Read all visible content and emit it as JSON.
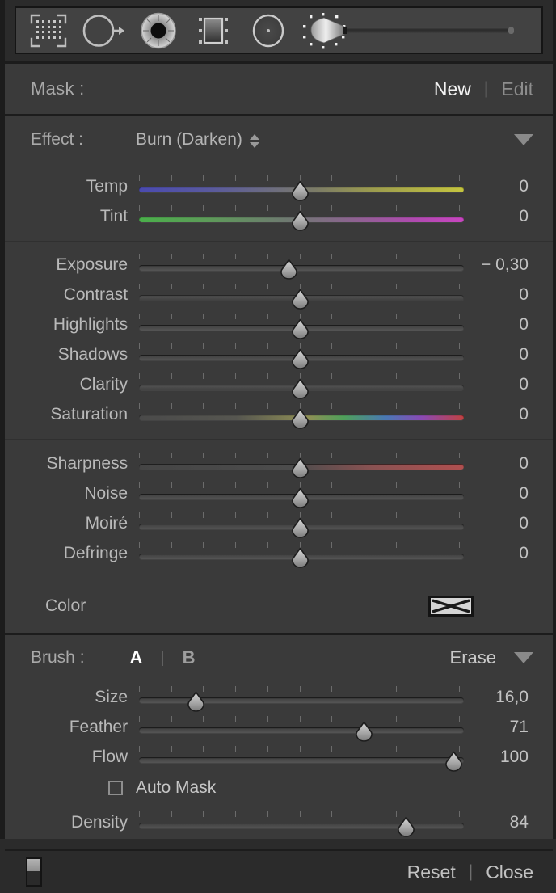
{
  "toolbar": {
    "tools": [
      {
        "name": "crop-overlay-icon",
        "label": "Crop Overlay"
      },
      {
        "name": "spot-removal-icon",
        "label": "Spot Removal"
      },
      {
        "name": "red-eye-icon",
        "label": "Red Eye Correction"
      },
      {
        "name": "graduated-filter-icon",
        "label": "Graduated Filter"
      },
      {
        "name": "radial-filter-icon",
        "label": "Radial Filter"
      },
      {
        "name": "adjustment-brush-icon",
        "label": "Adjustment Brush"
      }
    ],
    "active_tool": "Adjustment Brush"
  },
  "mask": {
    "label": "Mask :",
    "new_label": "New",
    "edit_label": "Edit",
    "divider": "|"
  },
  "effect": {
    "label": "Effect :",
    "value": "Burn (Darken)",
    "options": [
      "Burn (Darken)"
    ]
  },
  "sliders_white_balance": [
    {
      "name": "temp",
      "label": "Temp",
      "value": "0",
      "pos": 50,
      "grad": "grad-temp"
    },
    {
      "name": "tint",
      "label": "Tint",
      "value": "0",
      "pos": 50,
      "grad": "grad-tint"
    }
  ],
  "sliders_tone": [
    {
      "name": "exposure",
      "label": "Exposure",
      "value": "− 0,30",
      "pos": 46.5,
      "grad": ""
    },
    {
      "name": "contrast",
      "label": "Contrast",
      "value": "0",
      "pos": 50,
      "grad": "lighttop"
    },
    {
      "name": "highlights",
      "label": "Highlights",
      "value": "0",
      "pos": 50,
      "grad": ""
    },
    {
      "name": "shadows",
      "label": "Shadows",
      "value": "0",
      "pos": 50,
      "grad": ""
    },
    {
      "name": "clarity",
      "label": "Clarity",
      "value": "0",
      "pos": 50,
      "grad": "lighttop"
    },
    {
      "name": "saturation",
      "label": "Saturation",
      "value": "0",
      "pos": 50,
      "grad": "grad-sat"
    }
  ],
  "sliders_detail": [
    {
      "name": "sharpness",
      "label": "Sharpness",
      "value": "0",
      "pos": 50,
      "grad": "grad-sharp"
    },
    {
      "name": "noise",
      "label": "Noise",
      "value": "0",
      "pos": 50,
      "grad": ""
    },
    {
      "name": "moire",
      "label": "Moiré",
      "value": "0",
      "pos": 50,
      "grad": ""
    },
    {
      "name": "defringe",
      "label": "Defringe",
      "value": "0",
      "pos": 50,
      "grad": ""
    }
  ],
  "color": {
    "label": "Color",
    "swatch_state": "none"
  },
  "brush": {
    "label": "Brush :",
    "a_label": "A",
    "b_label": "B",
    "divider": "|",
    "erase_label": "Erase",
    "active_brush": "A",
    "sliders": [
      {
        "name": "size",
        "label": "Size",
        "value": "16,0",
        "pos": 17.5
      },
      {
        "name": "feather",
        "label": "Feather",
        "value": "71",
        "pos": 70
      },
      {
        "name": "flow",
        "label": "Flow",
        "value": "100",
        "pos": 98
      }
    ],
    "auto_mask": {
      "label": "Auto Mask",
      "checked": false
    },
    "density": {
      "name": "density",
      "label": "Density",
      "value": "84",
      "pos": 83
    }
  },
  "footer": {
    "reset_label": "Reset",
    "close_label": "Close",
    "divider": "|",
    "switch_state": "on"
  },
  "colors": {
    "panel_bg": "#3a3a3a",
    "toolbar_bg": "#424242",
    "text_primary": "#c2c2c2",
    "text_active": "#ffffff",
    "text_dim": "#8d8d8d",
    "border_dark": "#1c1c1c"
  }
}
